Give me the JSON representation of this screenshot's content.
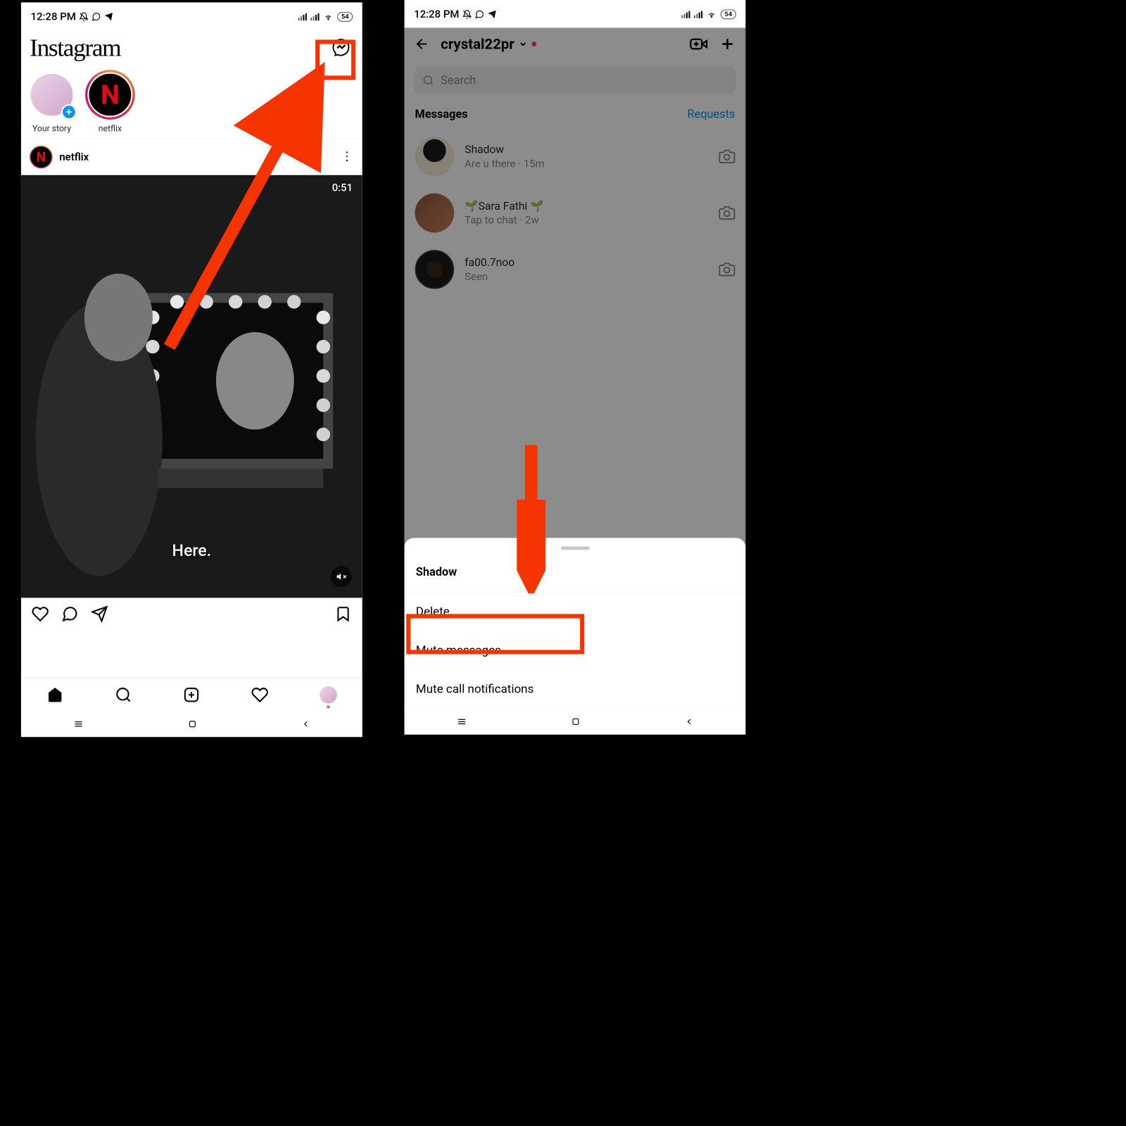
{
  "statusbar": {
    "time": "12:28 PM",
    "battery": "54"
  },
  "left": {
    "logo": "Instagram",
    "stories": [
      {
        "label": "Your story",
        "isOwn": true
      },
      {
        "label": "netflix",
        "isOwn": false
      }
    ],
    "post": {
      "author": "netflix",
      "timecode": "0:51",
      "caption": "Here."
    }
  },
  "right": {
    "username": "crystal22pr",
    "search_placeholder": "Search",
    "tabs": {
      "messages": "Messages",
      "requests": "Requests"
    },
    "chats": [
      {
        "name": "Shadow",
        "sub": "Are u there · 15m"
      },
      {
        "name": "🌱Sara Fathi 🌱",
        "sub": "Tap to chat · 2w"
      },
      {
        "name": "fa00.7noo",
        "sub": "Seen"
      }
    ],
    "sheet": {
      "title": "Shadow",
      "items": [
        "Delete",
        "Mute messages",
        "Mute call notifications"
      ]
    }
  }
}
